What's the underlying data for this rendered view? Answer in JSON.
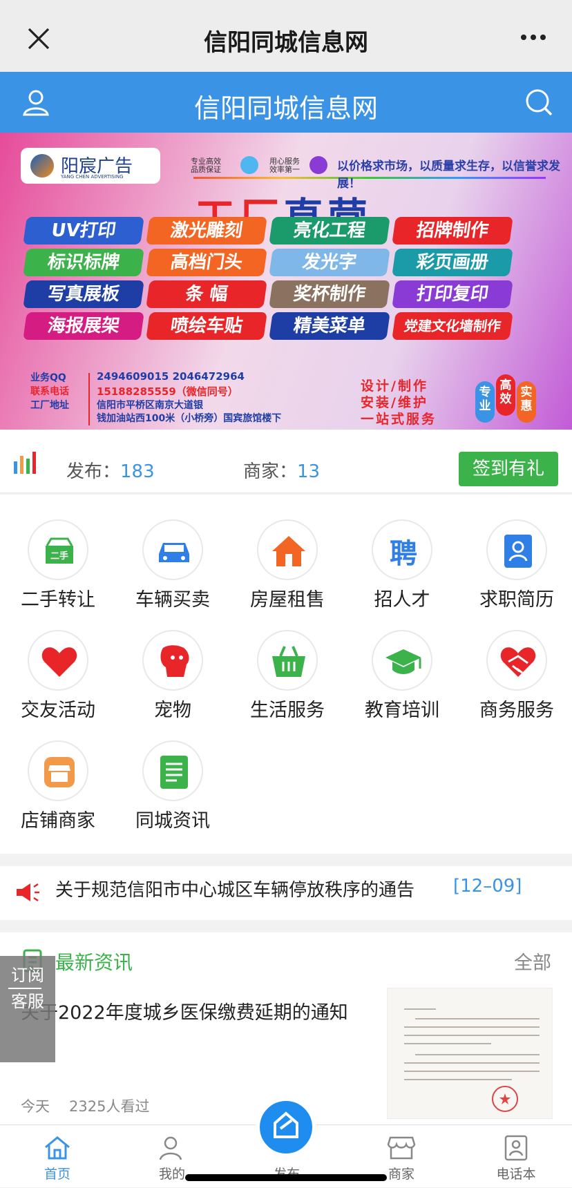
{
  "wechat": {
    "title": "信阳同城信息网"
  },
  "header": {
    "title": "信阳同城信息网"
  },
  "banner": {
    "logo_name": "阳宸广告",
    "logo_en": "YANG CHEN ADVERTISING",
    "tag1": "专业高效\n品质保证",
    "tag2": "用心服务\n效率第一",
    "slogan": "以价格求市场，以质量求生存，以信誉求发展！",
    "title_red": "工厂",
    "title_blue": "直营",
    "services": [
      "UV打印",
      "激光雕刻",
      "亮化工程",
      "招牌制作",
      "标识标牌",
      "高档门头",
      "发光字",
      "彩页画册",
      "写真展板",
      "条 幅",
      "奖杯制作",
      "打印复印",
      "海报展架",
      "喷绘车贴",
      "精美菜单",
      "党建文化墙制作"
    ],
    "contact_labels": [
      "业务QQ",
      "联系电话",
      "工厂地址"
    ],
    "qq": "2494609015      2046472964",
    "phone": "15188285559（微信同号）",
    "address1": "信阳市平桥区南京大道银",
    "address2": "钱加油站西100米（小桥旁）国宾旅馆楼下",
    "design": [
      "设计/制作",
      "安装/维护",
      "一站式服务"
    ],
    "badges": [
      "专业",
      "高效",
      "实惠"
    ]
  },
  "stats": {
    "publish_label": "发布：",
    "publish_value": "183",
    "merchant_label": "商家：",
    "merchant_value": "13",
    "signin": "签到有礼"
  },
  "categories": [
    {
      "label": "二手转让",
      "icon": "secondhand-icon",
      "color": "#3cb24a"
    },
    {
      "label": "车辆买卖",
      "icon": "car-icon",
      "color": "#2f7fe6"
    },
    {
      "label": "房屋租售",
      "icon": "house-icon",
      "color": "#f26522"
    },
    {
      "label": "招人才",
      "icon": "recruit-icon",
      "color": "#2f7fe6"
    },
    {
      "label": "求职简历",
      "icon": "resume-icon",
      "color": "#2f7fe6"
    },
    {
      "label": "交友活动",
      "icon": "heart-icon",
      "color": "#e8262a"
    },
    {
      "label": "宠物",
      "icon": "dog-icon",
      "color": "#e8262a"
    },
    {
      "label": "生活服务",
      "icon": "basket-icon",
      "color": "#3cb24a"
    },
    {
      "label": "教育培训",
      "icon": "graduation-cap-icon",
      "color": "#3cb24a"
    },
    {
      "label": "商务服务",
      "icon": "handshake-icon",
      "color": "#e8262a"
    },
    {
      "label": "店铺商家",
      "icon": "shop-icon",
      "color": "#f2994a"
    },
    {
      "label": "同城资讯",
      "icon": "news-doc-icon",
      "color": "#3cb24a"
    }
  ],
  "notice": {
    "text": "关于规范信阳市中心城区车辆停放秩序的通告",
    "date": "[12–09]"
  },
  "news": {
    "heading": "最新资讯",
    "all": "全部",
    "title": "关于2022年度城乡医保缴费延期的通知",
    "time": "今天",
    "views": "2325人看过"
  },
  "side": {
    "subscribe": "订阅",
    "service": "客服"
  },
  "tabs": [
    {
      "label": "首页",
      "icon": "home-icon"
    },
    {
      "label": "我的",
      "icon": "user-icon"
    },
    {
      "label": "发布",
      "icon": "publish-icon"
    },
    {
      "label": "商家",
      "icon": "store-icon"
    },
    {
      "label": "电话本",
      "icon": "contacts-icon"
    }
  ],
  "colors": {
    "primary": "#3b93e5",
    "green": "#3cb24a",
    "red": "#e8262a"
  }
}
